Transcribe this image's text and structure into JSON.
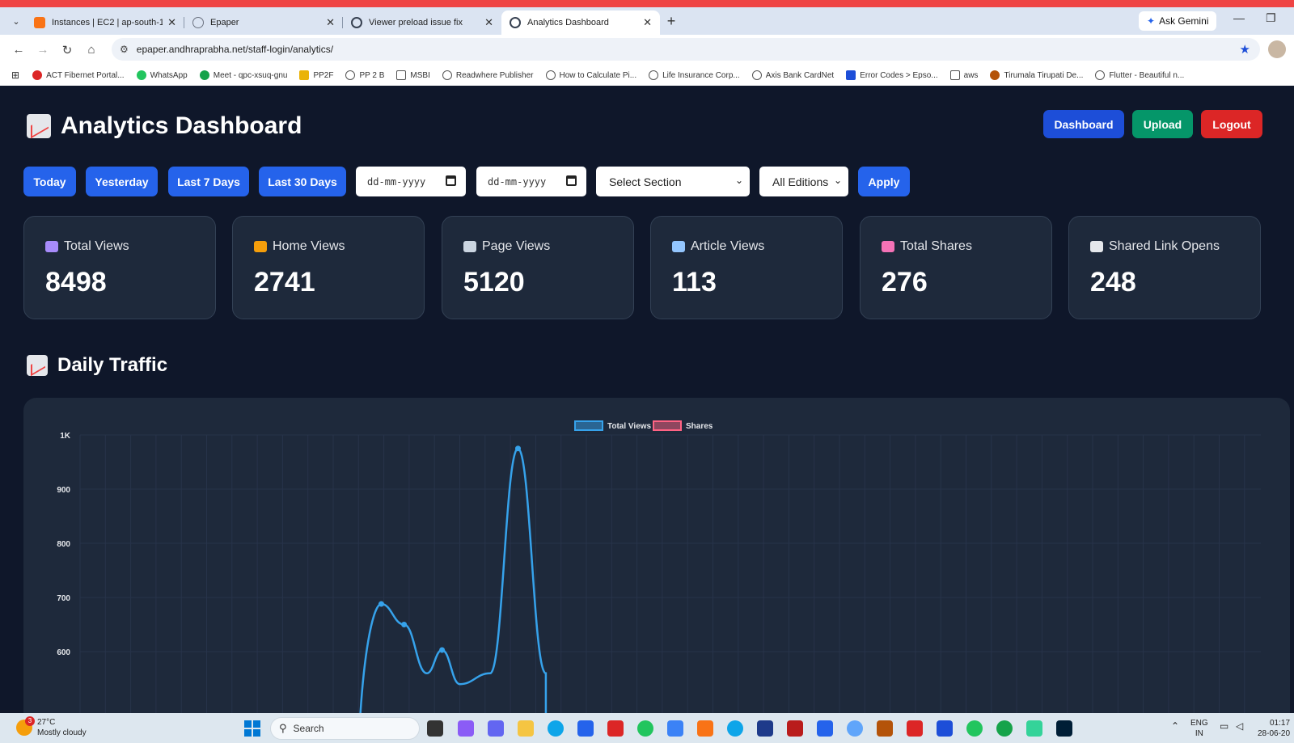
{
  "browser": {
    "tabs": [
      {
        "title": "Instances | EC2 | ap-south-1",
        "favicon_color": "#f97316",
        "active": false
      },
      {
        "title": "Epaper",
        "favicon_color": "#6b7280",
        "active": false
      },
      {
        "title": "Viewer preload issue fix",
        "favicon_color": "#374151",
        "active": false
      },
      {
        "title": "Analytics Dashboard",
        "favicon_color": "#374151",
        "active": true
      }
    ],
    "new_tab": "+",
    "ask_gemini": "Ask Gemini",
    "url": "epaper.andhraprabha.net/staff-login/analytics/",
    "bookmarks": [
      {
        "label": "ACT Fibernet Portal...",
        "color": "#dc2626"
      },
      {
        "label": "WhatsApp",
        "color": "#22c55e"
      },
      {
        "label": "Meet - qpc-xsuq-gnu",
        "color": "#16a34a"
      },
      {
        "label": "PP2F",
        "color": "#eab308"
      },
      {
        "label": "PP 2 B",
        "color": "#6b7280"
      },
      {
        "label": "MSBI",
        "color": "#9ca3af"
      },
      {
        "label": "Readwhere Publisher",
        "color": "#6b7280"
      },
      {
        "label": "How to Calculate Pi...",
        "color": "#6b7280"
      },
      {
        "label": "Life Insurance Corp...",
        "color": "#6b7280"
      },
      {
        "label": "Axis Bank CardNet",
        "color": "#6b7280"
      },
      {
        "label": "Error Codes > Epso...",
        "color": "#1d4ed8"
      },
      {
        "label": "aws",
        "color": "#9ca3af"
      },
      {
        "label": "Tirumala Tirupati De...",
        "color": "#b45309"
      },
      {
        "label": "Flutter - Beautiful n...",
        "color": "#6b7280"
      }
    ]
  },
  "page": {
    "title": "Analytics Dashboard",
    "buttons": {
      "dashboard": "Dashboard",
      "upload": "Upload",
      "logout": "Logout"
    },
    "filters": {
      "today": "Today",
      "yesterday": "Yesterday",
      "last7": "Last 7 Days",
      "last30": "Last 30 Days",
      "from_date": "dd-mm-yyyy",
      "to_date": "dd-mm-yyyy",
      "section": "Select Section",
      "edition": "All Editions",
      "apply": "Apply"
    },
    "stats": [
      {
        "label": "Total Views",
        "value": "8498",
        "icon": "eyes-icon",
        "icon_color": "#a78bfa"
      },
      {
        "label": "Home Views",
        "value": "2741",
        "icon": "house-icon",
        "icon_color": "#f59e0b"
      },
      {
        "label": "Page Views",
        "value": "5120",
        "icon": "newspaper-icon",
        "icon_color": "#cbd5e1"
      },
      {
        "label": "Article Views",
        "value": "113",
        "icon": "book-icon",
        "icon_color": "#93c5fd"
      },
      {
        "label": "Total Shares",
        "value": "276",
        "icon": "outbox-icon",
        "icon_color": "#f472b6"
      },
      {
        "label": "Shared Link Opens",
        "value": "248",
        "icon": "link-icon",
        "icon_color": "#e5e7eb"
      }
    ],
    "section_title": "Daily Traffic"
  },
  "chart_data": {
    "type": "line",
    "title": "",
    "legend_position": "top-center",
    "grid": true,
    "y_ticks": [
      "1K",
      "900",
      "800",
      "700",
      "600"
    ],
    "ylim_visible": [
      520,
      1000
    ],
    "series": [
      {
        "name": "Total Views",
        "color": "#36a2eb",
        "points": [
          {
            "x": 11.0,
            "y": 600
          },
          {
            "x": 11.9,
            "y": 688
          },
          {
            "x": 12.8,
            "y": 650
          },
          {
            "x": 13.7,
            "y": 560
          },
          {
            "x": 14.3,
            "y": 603
          },
          {
            "x": 15.0,
            "y": 540
          },
          {
            "x": 16.2,
            "y": 560
          },
          {
            "x": 17.3,
            "y": 975
          },
          {
            "x": 18.4,
            "y": 560
          }
        ],
        "markers": [
          {
            "x": 11.9,
            "y": 688
          },
          {
            "x": 12.8,
            "y": 650
          },
          {
            "x": 14.3,
            "y": 603
          },
          {
            "x": 17.3,
            "y": 975
          }
        ]
      },
      {
        "name": "Shares",
        "color": "#ff6384",
        "points": []
      }
    ]
  },
  "taskbar": {
    "weather_temp": "27°C",
    "weather_desc": "Mostly cloudy",
    "weather_badge": "3",
    "search": "Search",
    "lang_line1": "ENG",
    "lang_line2": "IN",
    "time": "01:17",
    "date": "28-06-20"
  }
}
